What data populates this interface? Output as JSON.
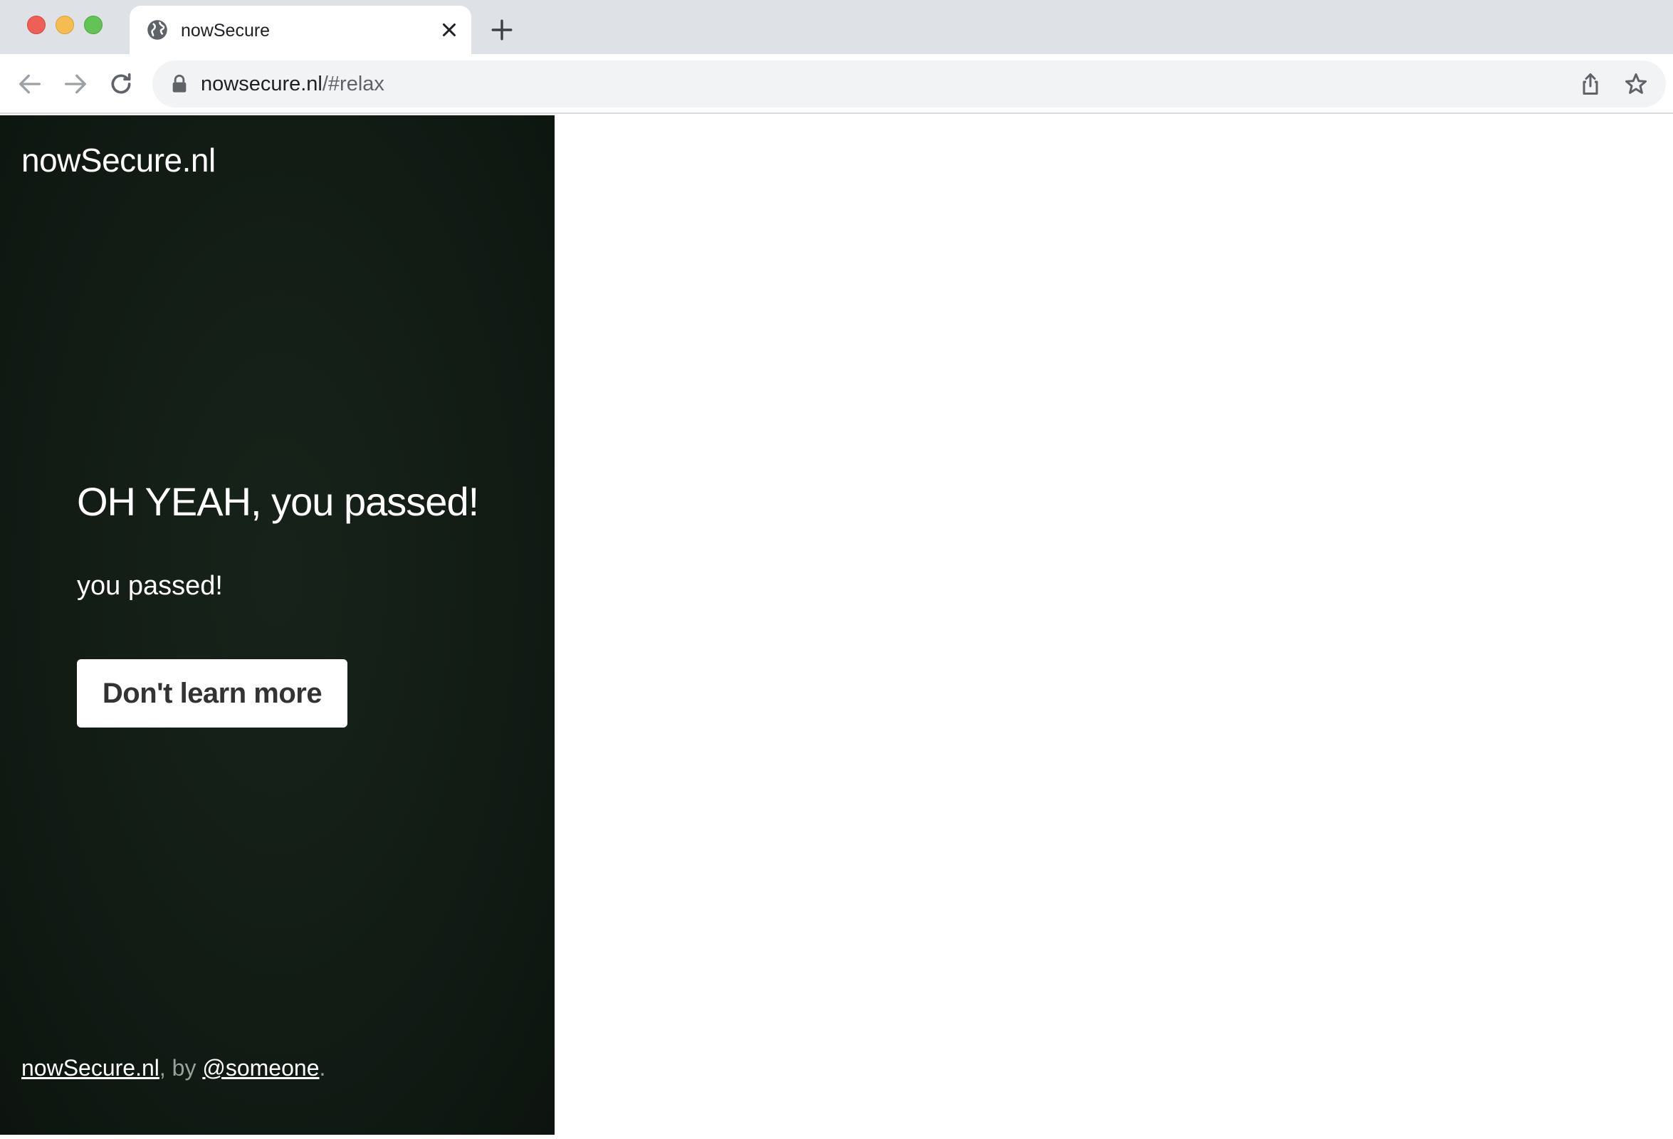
{
  "browser": {
    "tab": {
      "title": "nowSecure",
      "favicon": "globe-icon"
    },
    "address_bar": {
      "host": "nowsecure.nl",
      "path": "/#relax"
    },
    "icons": {
      "back": "arrow-left-icon",
      "forward": "arrow-right-icon",
      "reload": "reload-icon",
      "lock": "lock-icon",
      "share": "share-icon",
      "bookmark": "star-icon",
      "close": "close-icon",
      "new_tab": "plus-icon"
    }
  },
  "sidebar": {
    "brand": "nowSecure.nl",
    "headline": "OH YEAH, you passed!",
    "subtext": "you passed!",
    "button_label": "Don't learn more",
    "footer": {
      "site_link": "nowSecure.nl",
      "by_text": ", by ",
      "author_link": "@someone",
      "end_text": "."
    }
  },
  "colors": {
    "sidebar_bg": "#121c15",
    "button_bg": "#ffffff",
    "button_text": "#333333"
  }
}
